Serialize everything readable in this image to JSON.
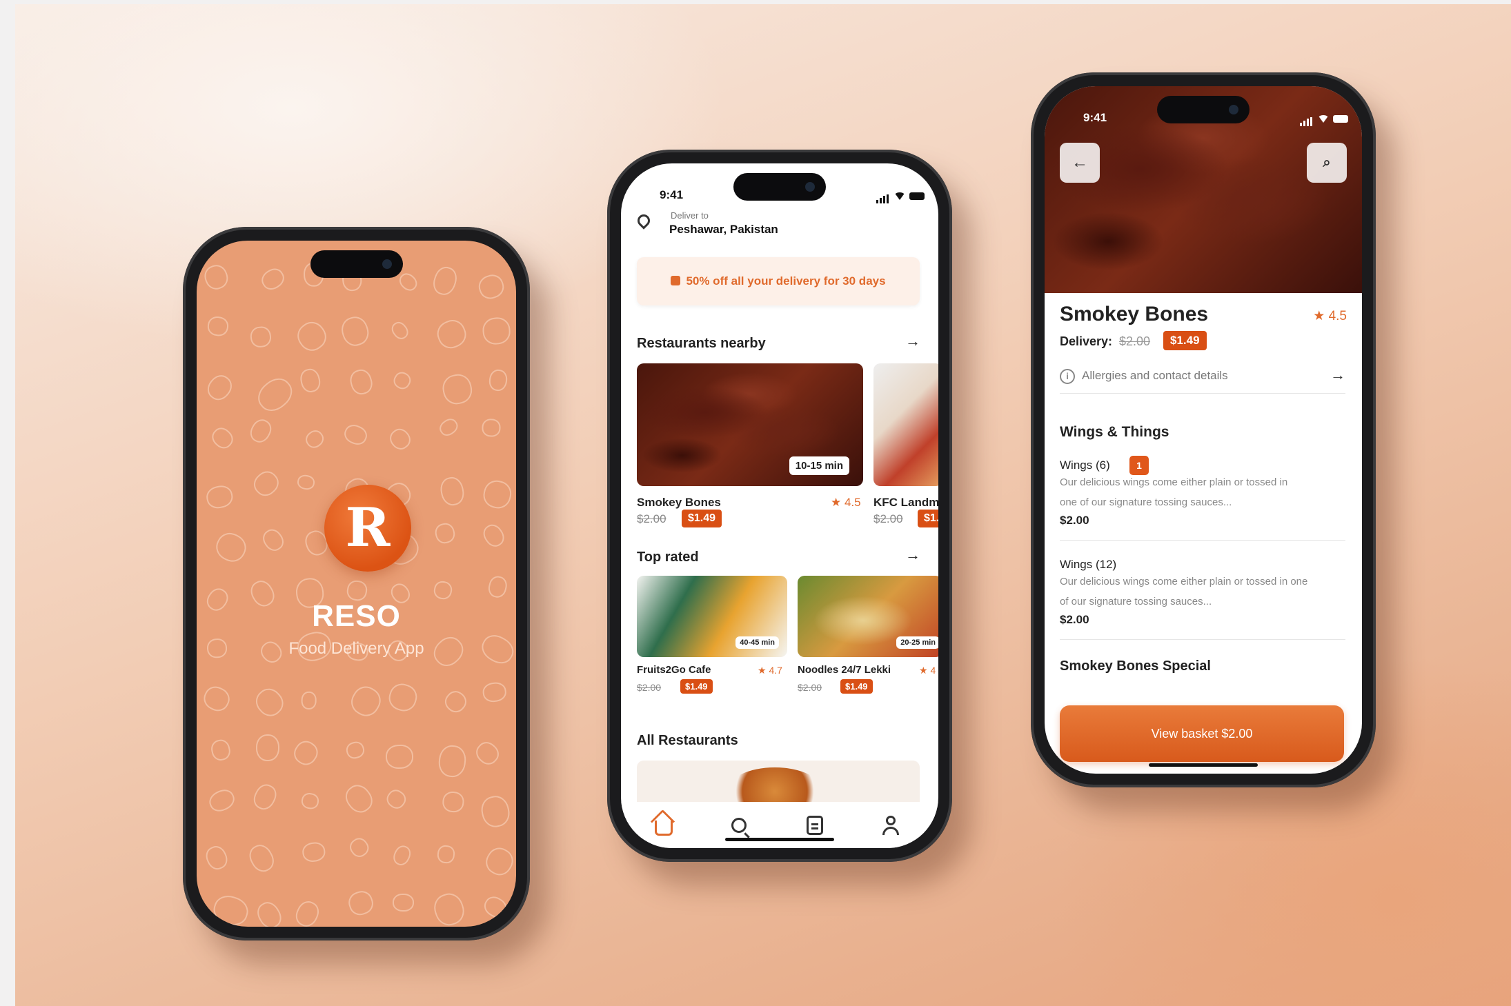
{
  "colors": {
    "accent": "#d94f14",
    "splash_bg": "#e89d74",
    "text_dark": "#222222"
  },
  "splash": {
    "logo_letter": "R",
    "app_name": "RESO",
    "tagline": "Food Delivery App"
  },
  "home": {
    "status_time": "9:41",
    "deliver_label": "Deliver to",
    "deliver_location": "Peshawar, Pakistan",
    "promo_text": "50% off all your delivery for 30 days",
    "nearby_title": "Restaurants nearby",
    "nearby": [
      {
        "name": "Smokey Bones",
        "rating": "4.5",
        "time": "10-15 min",
        "old_price": "$2.00",
        "new_price": "$1.49"
      },
      {
        "name": "KFC Landm",
        "old_price": "$2.00",
        "new_price": "$1."
      }
    ],
    "top_rated_title": "Top rated",
    "top_rated": [
      {
        "name": "Fruits2Go Cafe",
        "rating": "4.7",
        "time": "40-45 min",
        "old_price": "$2.00",
        "new_price": "$1.49"
      },
      {
        "name": "Noodles 24/7 Lekki",
        "rating": "4",
        "time": "20-25 min",
        "old_price": "$2.00",
        "new_price": "$1.49"
      }
    ],
    "all_title": "All Restaurants",
    "nav": [
      "home-icon",
      "search-icon",
      "orders-icon",
      "profile-icon"
    ]
  },
  "detail": {
    "status_time": "9:41",
    "title": "Smokey Bones",
    "rating": "4.5",
    "delivery_label": "Delivery:",
    "delivery_old": "$2.00",
    "delivery_new": "$1.49",
    "allergy_text": "Allergies and contact details",
    "section1": "Wings & Things",
    "items": [
      {
        "name": "Wings (6)",
        "qty": "1",
        "desc_l1": "Our delicious wings come either plain or tossed in",
        "desc_l2": "one of our signature tossing sauces...",
        "price": "$2.00"
      },
      {
        "name": "Wings (12)",
        "desc_l1": "Our delicious wings come either plain or tossed in one",
        "desc_l2": "of our signature tossing sauces...",
        "price": "$2.00"
      }
    ],
    "section2": "Smokey Bones Special",
    "basket_label": "View basket $2.00"
  }
}
